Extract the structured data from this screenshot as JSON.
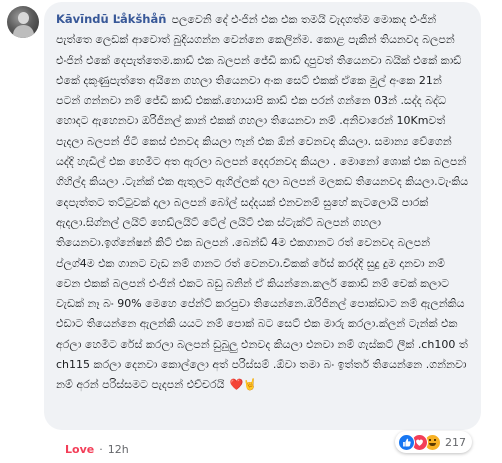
{
  "comment": {
    "author": "Kāvīndū Ŀåkšhåñ",
    "body": "පලවෙනි දේ එංජින් එක එක තමයි වැදගත්ම මොකද එංජින් පැත්තෙ ලෙඩක් ආවොත් බුදියගන්න වෙන්නෙ කෙලින්ම. කොළ පැකින් තියනවද බලපන් එංජින් එකේ දෙපැත්තෙම.කාඩ් එක බලපන් ජේඩි කාඩ් දාපුවත් තියෙනවා බයික් එකේ කාඩ් එකේ දකුණුපැත්තෙ අයිනෙ ගහලා තියෙනවා අංක සෙට් එකක් ඒකෙ මුල් අංකෙ 21න් පටන් ගන්නවා නම් ජේඩි කාඩ් එකක්.හොයාපි කාඩ් එක පරන් ගන්නෙ 03න් .සද්ද බද්ධ හොදට ඇහෙනවා ඔරිජිනල් කාන් එකක් ගහලා තියෙනවා නම් .අනිවාරෙන් 10Kmවත් පැදලා බලපන් ජීටී කෙස් එනවද කියලා ෆෑන් එක ඕන් වෙනවද කියලා. සමාන්‍ය වේගෙන් යද්දි හැඩිල් එක හෙමිට අත ඇරලා බලපන් දෙදරනවද කියලා . මොනෝ ශොක් එක බලපන් ගිහිල්ද කියලා .ටැන්ක් එක ඇතුලට ඇගිල්ලක් දාලා බලපන් මලකඩ තියෙනවද කියලා.ටැංකිය දෙපැත්තට තට්ටුවක් දාලා බලපන් බෝල් සද්දයක් එනවනම් සුහේ කැටලොයි පාරක් ඇදලා.සිග්නල් ලයිට් හෙඩ්ලයිට් ටේල් ලයිට් එක ස්ටැක්ට් බලපන් ගහලා තියෙනවා.ඉග්නේෂන් කිට් එක බලපන් .බෙන්ඩ් 4ම එකගානට රත් වෙනවද බලපන් ප්ලග්4ම එක ගානට වැඩ නම් ගානට රත් වෙනවා.චිකක් රේස් කරද්දි සුදු දුම දානවා නම් වෙන එකක් බලපන් එංජින් එකට බඩු බනින් ඒ කියන්නෙ.කලර් කොඩ් නම් චෙක් කලාට වැඩක් නෑ බං 90% මෙහෙ පේන්ට් කරපුවා තියෙන්නෙ.ඔරිජිනල් පොක්ඩාට නම් ඇලන්කිය එඩාට තියෙන්නෙ ඇලන්කි යයට නම් පොක් බට සෙට් එක මාරු කරලා.ක්ලන් ටැන්ක් එක අරලා හෙමීට රේස් කරලා බලපන් ඩුබුලු එනවද කියලා එනවා නම් ගැස්කට් ලීක් .ch100 ත් ch115 කරලා දෙනවා කොල්ලො අත් පරිස්සම් .ඕවා තමා බං ඉත්තර් තියෙන්නෙ .ගන්නවා නම් අරන් පරිස්සමට පැදපන් එච්චරයි",
    "emoji_trail": "❤️🤘",
    "reaction_count": "217",
    "love_label": "Love",
    "separator": "·",
    "time_label": "12h"
  },
  "colors": {
    "author": "#385898",
    "bubble_bg": "#f0f2f5",
    "love": "#f33e58",
    "like": "#1877f2",
    "meta": "#65676b"
  },
  "icons": {
    "reactions": [
      "like-icon",
      "love-icon",
      "haha-icon"
    ]
  }
}
